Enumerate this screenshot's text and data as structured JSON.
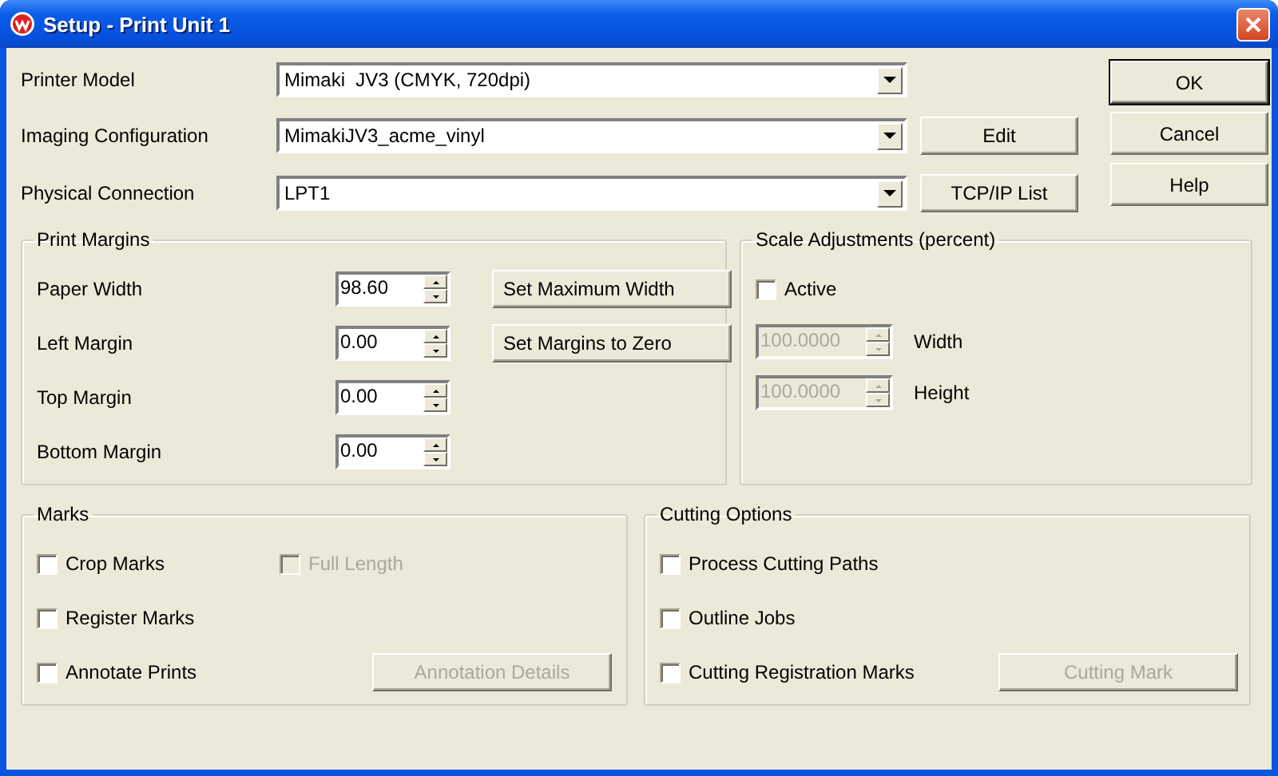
{
  "window": {
    "title": "Setup - Print Unit 1"
  },
  "fields": [
    {
      "label": "Printer Model",
      "value": "Mimaki  JV3 (CMYK, 720dpi)"
    },
    {
      "label": "Imaging Configuration",
      "value": "MimakiJV3_acme_vinyl",
      "button": "Edit"
    },
    {
      "label": "Physical Connection",
      "value": "LPT1",
      "button": "TCP/IP List"
    }
  ],
  "dialog_buttons": [
    {
      "label": "OK",
      "default": true
    },
    {
      "label": "Cancel",
      "default": false
    },
    {
      "label": "Help",
      "default": false
    }
  ],
  "print_margins": {
    "title": "Print Margins",
    "rows": [
      {
        "label": "Paper Width",
        "value": "98.60",
        "button": "Set Maximum Width"
      },
      {
        "label": "Left Margin",
        "value": "0.00",
        "button": "Set Margins to Zero"
      },
      {
        "label": "Top Margin",
        "value": "0.00"
      },
      {
        "label": "Bottom Margin",
        "value": "0.00"
      }
    ]
  },
  "scale_adjustments": {
    "title": "Scale Adjustments (percent)",
    "active": {
      "label": "Active",
      "checked": false
    },
    "rows": [
      {
        "value": "100.0000",
        "label": "Width",
        "disabled": true
      },
      {
        "value": "100.0000",
        "label": "Height",
        "disabled": true
      }
    ]
  },
  "marks": {
    "title": "Marks",
    "rows": [
      [
        {
          "kind": "checkbox",
          "label": "Crop Marks",
          "checked": false,
          "disabled": false
        },
        {
          "kind": "checkbox",
          "label": "Full Length",
          "checked": false,
          "disabled": true
        }
      ],
      [
        {
          "kind": "checkbox",
          "label": "Register Marks",
          "checked": false,
          "disabled": false
        }
      ],
      [
        {
          "kind": "checkbox",
          "label": "Annotate Prints",
          "checked": false,
          "disabled": false
        },
        {
          "kind": "button",
          "label": "Annotation Details",
          "disabled": true
        }
      ]
    ]
  },
  "cutting_options": {
    "title": "Cutting Options",
    "rows": [
      [
        {
          "kind": "checkbox",
          "label": "Process Cutting Paths",
          "checked": false,
          "disabled": false
        }
      ],
      [
        {
          "kind": "checkbox",
          "label": "Outline Jobs",
          "checked": false,
          "disabled": false
        }
      ],
      [
        {
          "kind": "checkbox",
          "label": "Cutting Registration Marks",
          "checked": false,
          "disabled": false
        },
        {
          "kind": "button",
          "label": "Cutting Mark",
          "disabled": true
        }
      ]
    ]
  }
}
